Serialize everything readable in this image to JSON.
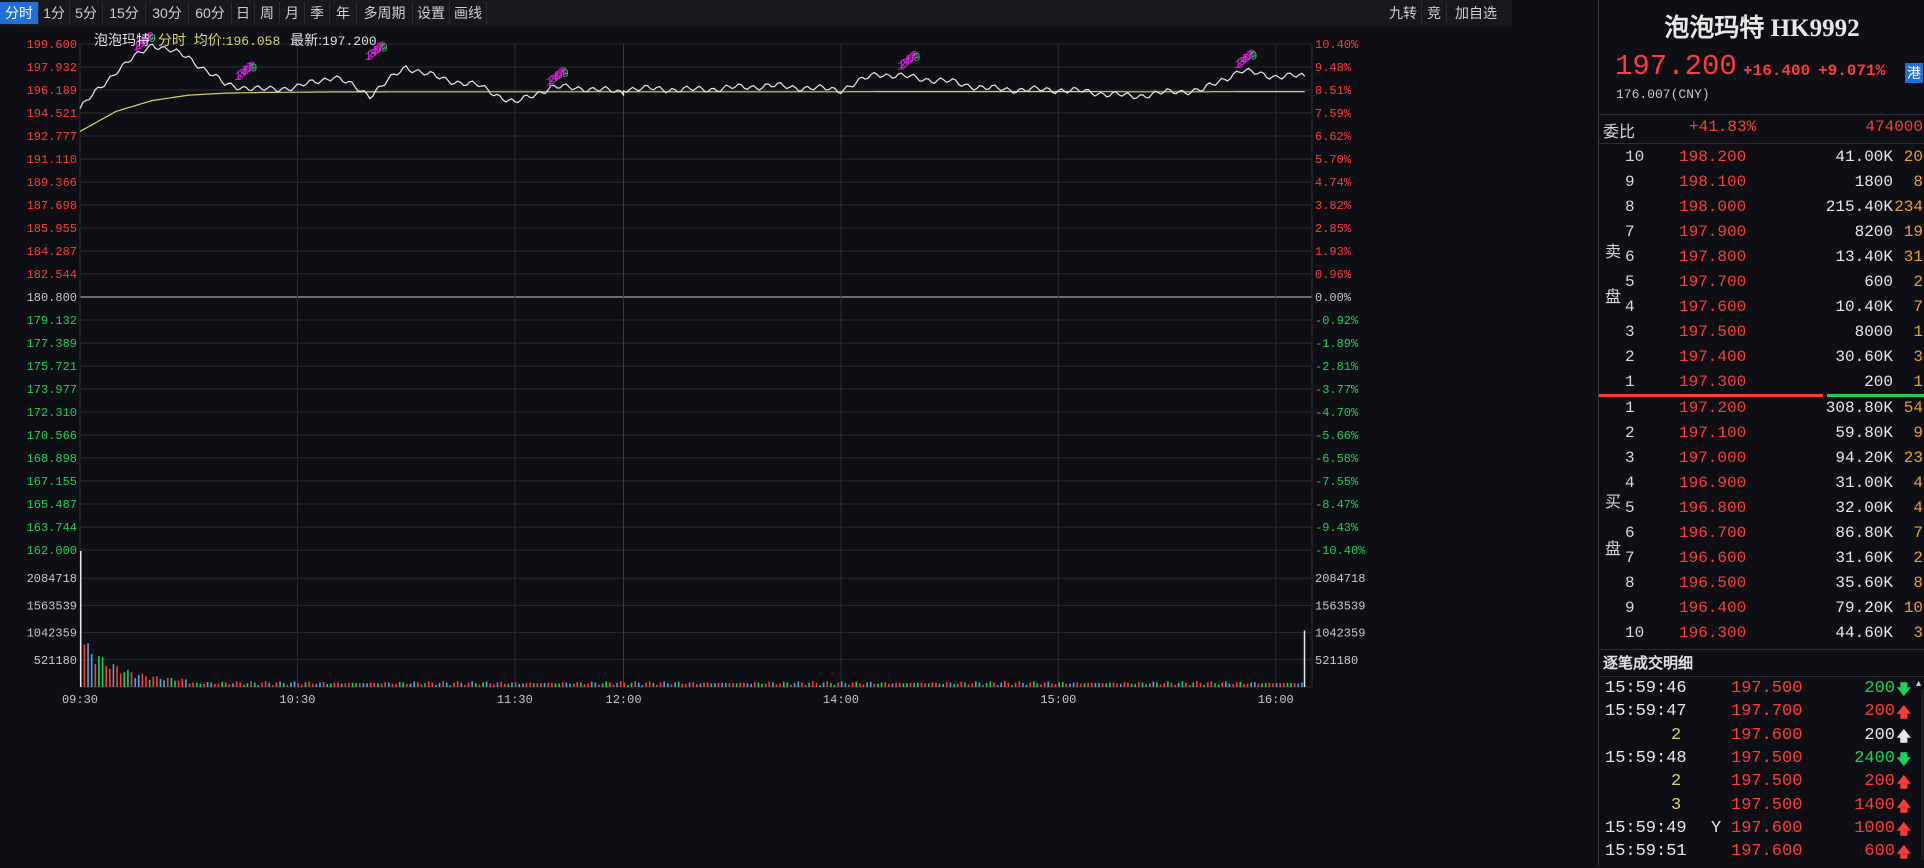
{
  "toolbar": {
    "periods": [
      "分时",
      "1分",
      "5分",
      "15分",
      "30分",
      "60分",
      "日",
      "周",
      "月",
      "季",
      "年",
      "多周期",
      "设置",
      "画线"
    ],
    "right": [
      "九转",
      "竞",
      "加自选"
    ]
  },
  "chart": {
    "legend": {
      "name": "泡泡玛特",
      "mode": "分时",
      "avg_label": "均价:",
      "avg_value": "196.058",
      "last_label": "最新:",
      "last_value": "197.200"
    },
    "price_ticks": [
      "199.600",
      "197.932",
      "196.189",
      "194.521",
      "192.777",
      "191.110",
      "189.366",
      "187.698",
      "185.955",
      "184.287",
      "182.544",
      "180.800",
      "179.132",
      "177.389",
      "175.721",
      "173.977",
      "172.310",
      "170.566",
      "168.898",
      "167.155",
      "165.487",
      "163.744",
      "162.000"
    ],
    "pct_ticks": [
      "10.40%",
      "9.48%",
      "8.51%",
      "7.59%",
      "6.62%",
      "5.70%",
      "4.74%",
      "3.82%",
      "2.85%",
      "1.93%",
      "0.96%",
      "0.00%",
      "-0.92%",
      "-1.89%",
      "-2.81%",
      "-3.77%",
      "-4.70%",
      "-5.66%",
      "-6.58%",
      "-7.55%",
      "-8.47%",
      "-9.43%",
      "-10.40%"
    ],
    "vol_ticks": [
      "2084718",
      "1563539",
      "1042359",
      "521180"
    ],
    "time_ticks": [
      "09:30",
      "10:30",
      "11:30",
      "12:00",
      "14:00",
      "15:00",
      "16:00"
    ],
    "colors": {
      "up": "#ff3b3b",
      "down": "#19d15a",
      "price_line": "#e8e8e8",
      "avg_line": "#d8d56a",
      "grid": "#2a2d33",
      "zero": "#c8c8c8",
      "nine_magenta": "#e020e0",
      "nine_green": "#19d15a"
    }
  },
  "chart_data": {
    "type": "line",
    "title": "泡泡玛特 分时",
    "prev_close": 180.8,
    "ylim": [
      162.0,
      199.6
    ],
    "x": [
      "09:30",
      "09:40",
      "09:50",
      "10:00",
      "10:10",
      "10:20",
      "10:30",
      "10:40",
      "10:50",
      "11:00",
      "11:10",
      "11:20",
      "11:30",
      "11:40",
      "11:50",
      "12:00",
      "13:00",
      "13:20",
      "13:40",
      "14:00",
      "14:10",
      "14:20",
      "14:30",
      "14:40",
      "14:50",
      "15:00",
      "15:10",
      "15:20",
      "15:30",
      "15:40",
      "15:50",
      "16:00",
      "16:08"
    ],
    "series": [
      {
        "name": "最新",
        "values": [
          194.8,
          197.6,
          199.6,
          198.6,
          196.6,
          196.2,
          196.4,
          197.2,
          195.8,
          197.9,
          197.0,
          196.5,
          195.2,
          196.4,
          196.3,
          196.0,
          196.3,
          196.2,
          196.5,
          196.2,
          197.4,
          197.1,
          196.8,
          196.3,
          196.2,
          196.2,
          196.0,
          195.7,
          196.0,
          196.2,
          197.6,
          197.2,
          197.2
        ]
      },
      {
        "name": "均价",
        "values": [
          193.1,
          194.6,
          195.4,
          195.8,
          195.95,
          196.0,
          196.02,
          196.04,
          196.04,
          196.05,
          196.05,
          196.05,
          196.05,
          196.05,
          196.05,
          196.05,
          196.05,
          196.05,
          196.05,
          196.05,
          196.06,
          196.06,
          196.06,
          196.06,
          196.06,
          196.06,
          196.06,
          196.05,
          196.05,
          196.05,
          196.06,
          196.06,
          196.06
        ]
      }
    ],
    "volume_ylim": [
      0,
      2605897
    ],
    "opening_volume": 2605897,
    "closing_volume": 1082000
  },
  "quote": {
    "title": "泡泡玛特 HK9992",
    "price": "197.200",
    "change": "+16.400",
    "change_pct": "+9.071%",
    "market": "港",
    "cny": "176.007(CNY)",
    "weibi_label": "委比",
    "weibi_value": "+41.83%",
    "weicha_value": "474000",
    "sell_label_1": "卖",
    "sell_label_2": "盘",
    "buy_label_1": "买",
    "buy_label_2": "盘",
    "asks": [
      {
        "lvl": "10",
        "px": "198.200",
        "vol": "41.00K",
        "cnt": "20"
      },
      {
        "lvl": "9",
        "px": "198.100",
        "vol": "1800",
        "cnt": "8"
      },
      {
        "lvl": "8",
        "px": "198.000",
        "vol": "215.40K",
        "cnt": "234"
      },
      {
        "lvl": "7",
        "px": "197.900",
        "vol": "8200",
        "cnt": "19"
      },
      {
        "lvl": "6",
        "px": "197.800",
        "vol": "13.40K",
        "cnt": "31"
      },
      {
        "lvl": "5",
        "px": "197.700",
        "vol": "600",
        "cnt": "2"
      },
      {
        "lvl": "4",
        "px": "197.600",
        "vol": "10.40K",
        "cnt": "7"
      },
      {
        "lvl": "3",
        "px": "197.500",
        "vol": "8000",
        "cnt": "1"
      },
      {
        "lvl": "2",
        "px": "197.400",
        "vol": "30.60K",
        "cnt": "3"
      },
      {
        "lvl": "1",
        "px": "197.300",
        "vol": "200",
        "cnt": "1"
      }
    ],
    "bids": [
      {
        "lvl": "1",
        "px": "197.200",
        "vol": "308.80K",
        "cnt": "54"
      },
      {
        "lvl": "2",
        "px": "197.100",
        "vol": "59.80K",
        "cnt": "9"
      },
      {
        "lvl": "3",
        "px": "197.000",
        "vol": "94.20K",
        "cnt": "23"
      },
      {
        "lvl": "4",
        "px": "196.900",
        "vol": "31.00K",
        "cnt": "4"
      },
      {
        "lvl": "5",
        "px": "196.800",
        "vol": "32.00K",
        "cnt": "4"
      },
      {
        "lvl": "6",
        "px": "196.700",
        "vol": "86.80K",
        "cnt": "7"
      },
      {
        "lvl": "7",
        "px": "196.600",
        "vol": "31.60K",
        "cnt": "2"
      },
      {
        "lvl": "8",
        "px": "196.500",
        "vol": "35.60K",
        "cnt": "8"
      },
      {
        "lvl": "9",
        "px": "196.400",
        "vol": "79.20K",
        "cnt": "10"
      },
      {
        "lvl": "10",
        "px": "196.300",
        "vol": "44.60K",
        "cnt": "3"
      }
    ],
    "ticks_title": "逐笔成交明细",
    "ticks": [
      {
        "time": "15:59:46",
        "flag": "",
        "px": "197.500",
        "vol": "200",
        "dir": "down"
      },
      {
        "time": "15:59:47",
        "flag": "",
        "px": "197.700",
        "vol": "200",
        "dir": "up"
      },
      {
        "time": "2",
        "flag": "",
        "px": "197.600",
        "vol": "200",
        "dir": "neutral"
      },
      {
        "time": "15:59:48",
        "flag": "",
        "px": "197.500",
        "vol": "2400",
        "dir": "down"
      },
      {
        "time": "2",
        "flag": "",
        "px": "197.500",
        "vol": "200",
        "dir": "up"
      },
      {
        "time": "3",
        "flag": "",
        "px": "197.500",
        "vol": "1400",
        "dir": "up"
      },
      {
        "time": "15:59:49",
        "flag": "Y",
        "px": "197.600",
        "vol": "1000",
        "dir": "up"
      },
      {
        "time": "15:59:51",
        "flag": "",
        "px": "197.600",
        "vol": "600",
        "dir": "up"
      }
    ]
  }
}
